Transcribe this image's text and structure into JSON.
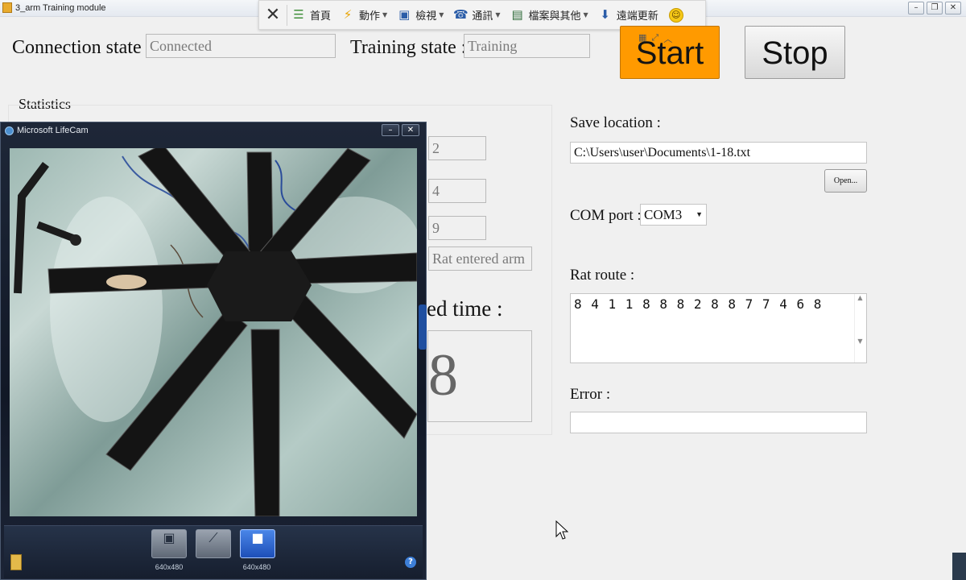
{
  "window": {
    "title": "3_arm Training module",
    "min": "–",
    "restore": "❐",
    "close": "✕"
  },
  "toolbar": {
    "close": "✕",
    "items": [
      {
        "label": "首頁",
        "icon": "home-circle-icon",
        "glyph": "☰"
      },
      {
        "label": "動作",
        "icon": "lightning-icon",
        "glyph": "⚡"
      },
      {
        "label": "檢視",
        "icon": "monitor-icon",
        "glyph": "▣"
      },
      {
        "label": "通訊",
        "icon": "phone-icon",
        "glyph": "☎"
      },
      {
        "label": "檔案與其他",
        "icon": "file-icon",
        "glyph": "▤"
      },
      {
        "label": "遠端更新",
        "icon": "download-icon",
        "glyph": "⬇"
      }
    ],
    "smiley": "☺"
  },
  "connection": {
    "label": "Connection state :",
    "value": "Connected"
  },
  "training": {
    "label": "Training state :",
    "value": "Training"
  },
  "buttons": {
    "start": "Start",
    "stop": "Stop"
  },
  "statistics": {
    "label": "Statistics",
    "values": [
      "2",
      "4",
      "9"
    ],
    "last_event": "Rat entered arm",
    "time_label": "ed time :",
    "time_value": "8"
  },
  "save": {
    "label": "Save location :",
    "path": "C:\\Users\\user\\Documents\\1-18.txt",
    "open": "Open..."
  },
  "com": {
    "label": "COM port :",
    "value": "COM3"
  },
  "route": {
    "label": "Rat route :",
    "value": "8 4 1 1 8 8 8 2 8 8 7 7 4 6 8"
  },
  "error": {
    "label": "Error :",
    "value": ""
  },
  "webcam": {
    "title": "Microsoft LifeCam",
    "res1": "640x480",
    "res2": "640x480",
    "help": "?"
  },
  "colors": {
    "start": "#ff9a00",
    "stop": "#e3e3e3"
  }
}
